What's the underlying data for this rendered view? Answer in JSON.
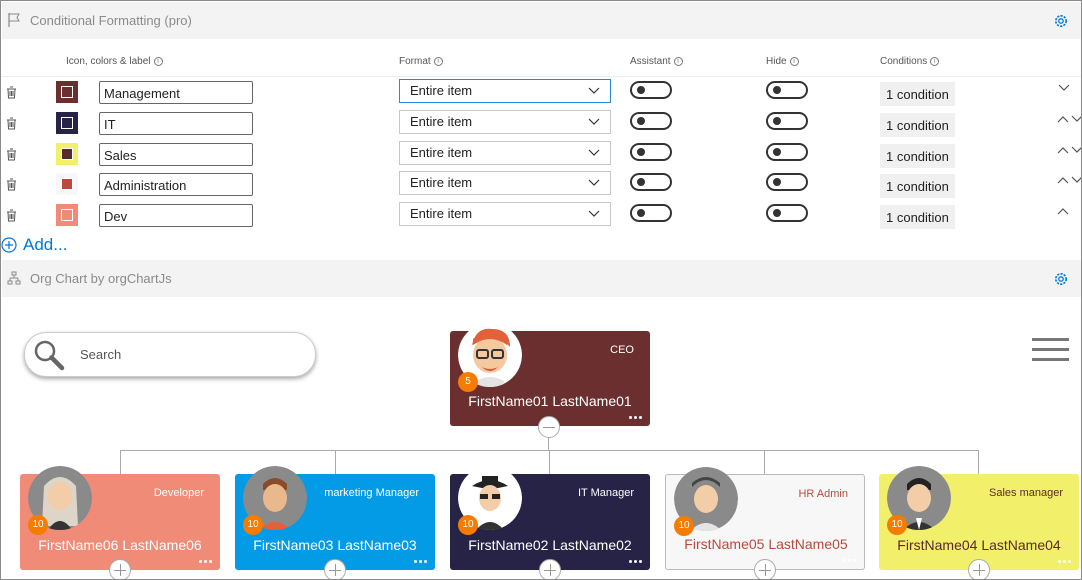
{
  "cf_section": {
    "title": "Conditional Formatting (pro)",
    "icon": "flag-icon",
    "settings_icon": "gear-icon"
  },
  "columns": {
    "icon_colors_label": "Icon, colors & label",
    "format": "Format",
    "assistant": "Assistant",
    "hide": "Hide",
    "conditions": "Conditions"
  },
  "rules": [
    {
      "label": "Management",
      "format": "Entire item",
      "assistant": false,
      "hide": false,
      "conditions": "1 condition",
      "swatch_color": "#6b2f2f",
      "inner_color": "#6b2f2f"
    },
    {
      "label": "IT",
      "format": "Entire item",
      "assistant": false,
      "hide": false,
      "conditions": "1 condition",
      "swatch_color": "#262346",
      "inner_color": "#262346"
    },
    {
      "label": "Sales",
      "format": "Entire item",
      "assistant": false,
      "hide": false,
      "conditions": "1 condition",
      "swatch_color": "#f2f06a",
      "inner_color": "#5a2a2a"
    },
    {
      "label": "Administration",
      "format": "Entire item",
      "assistant": false,
      "hide": false,
      "conditions": "1 condition",
      "swatch_color": "#f7f7f7",
      "inner_color": "#b94a3e"
    },
    {
      "label": "Dev",
      "format": "Entire item",
      "assistant": false,
      "hide": false,
      "conditions": "1 condition",
      "swatch_color": "#f08b77",
      "inner_color": "#f08b77"
    }
  ],
  "add_label": "Add...",
  "org_section": {
    "title": "Org Chart by orgChartJs",
    "icon": "org-chart-icon",
    "settings_icon": "gear-icon"
  },
  "search": {
    "placeholder": "Search"
  },
  "menu_icon": "hamburger-menu-icon",
  "colors": {
    "accent": "#0078d4",
    "badge": "#f57c00"
  },
  "org": {
    "root": {
      "role": "CEO",
      "name": "FirstName01 LastName01",
      "badge": "5",
      "color": "#6b2f2f",
      "text_color": "#ffffff"
    },
    "children": [
      {
        "role": "Developer",
        "name": "FirstName06 LastName06",
        "badge": "10",
        "color": "#f08b77",
        "text_color": "#ffffff"
      },
      {
        "role": "marketing Manager",
        "name": "FirstName03 LastName03",
        "badge": "10",
        "color": "#039be5",
        "text_color": "#ffffff"
      },
      {
        "role": "IT Manager",
        "name": "FirstName02 LastName02",
        "badge": "10",
        "color": "#262346",
        "text_color": "#ffffff"
      },
      {
        "role": "HR Admin",
        "name": "FirstName05 LastName05",
        "badge": "10",
        "color": "#f7f7f7",
        "text_color": "#b94a3e"
      },
      {
        "role": "Sales manager",
        "name": "FirstName04 LastName04",
        "badge": "10",
        "color": "#f2f06a",
        "text_color": "#5a2a2a"
      }
    ]
  }
}
